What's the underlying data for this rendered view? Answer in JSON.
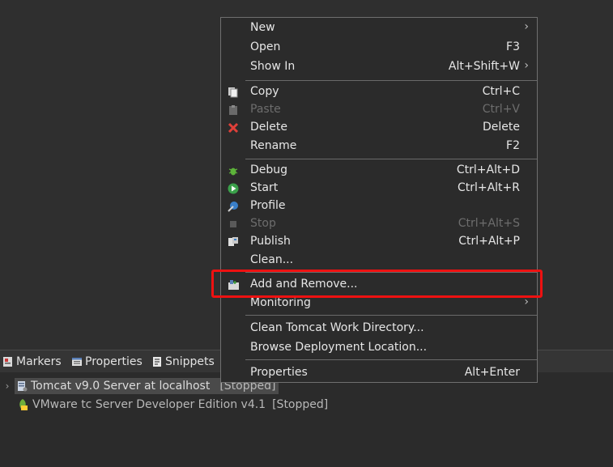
{
  "context_menu": {
    "items": [
      {
        "label": "New",
        "shortcut": "",
        "submenu": true,
        "icon": "",
        "enabled": true
      },
      {
        "label": "Open",
        "shortcut": "F3",
        "submenu": false,
        "icon": "",
        "enabled": true
      },
      {
        "label": "Show In",
        "shortcut": "Alt+Shift+W",
        "submenu": true,
        "icon": "",
        "enabled": true
      },
      {
        "label": "Copy",
        "shortcut": "Ctrl+C",
        "submenu": false,
        "icon": "copy-icon",
        "enabled": true
      },
      {
        "label": "Paste",
        "shortcut": "Ctrl+V",
        "submenu": false,
        "icon": "paste-icon",
        "enabled": false
      },
      {
        "label": "Delete",
        "shortcut": "Delete",
        "submenu": false,
        "icon": "delete-icon",
        "enabled": true
      },
      {
        "label": "Rename",
        "shortcut": "F2",
        "submenu": false,
        "icon": "",
        "enabled": true
      },
      {
        "label": "Debug",
        "shortcut": "Ctrl+Alt+D",
        "submenu": false,
        "icon": "debug-icon",
        "enabled": true
      },
      {
        "label": "Start",
        "shortcut": "Ctrl+Alt+R",
        "submenu": false,
        "icon": "start-icon",
        "enabled": true
      },
      {
        "label": "Profile",
        "shortcut": "",
        "submenu": false,
        "icon": "profile-icon",
        "enabled": true
      },
      {
        "label": "Stop",
        "shortcut": "Ctrl+Alt+S",
        "submenu": false,
        "icon": "stop-icon",
        "enabled": false
      },
      {
        "label": "Publish",
        "shortcut": "Ctrl+Alt+P",
        "submenu": false,
        "icon": "publish-icon",
        "enabled": true
      },
      {
        "label": "Clean...",
        "shortcut": "",
        "submenu": false,
        "icon": "",
        "enabled": true
      },
      {
        "label": "Add and Remove...",
        "shortcut": "",
        "submenu": false,
        "icon": "add-remove-icon",
        "enabled": true
      },
      {
        "label": "Monitoring",
        "shortcut": "",
        "submenu": true,
        "icon": "",
        "enabled": true
      },
      {
        "label": "Clean Tomcat Work Directory...",
        "shortcut": "",
        "submenu": false,
        "icon": "",
        "enabled": true
      },
      {
        "label": "Browse Deployment Location...",
        "shortcut": "",
        "submenu": false,
        "icon": "",
        "enabled": true
      },
      {
        "label": "Properties",
        "shortcut": "Alt+Enter",
        "submenu": false,
        "icon": "",
        "enabled": true
      }
    ],
    "submenu_arrow": "›",
    "highlight_color": "#ee1111"
  },
  "bottom_tabs": [
    {
      "label": "Markers",
      "icon": "markers-icon"
    },
    {
      "label": "Properties",
      "icon": "properties-icon"
    },
    {
      "label": "Snippets",
      "icon": "snippets-icon"
    }
  ],
  "servers": [
    {
      "name": "Tomcat v9.0 Server at localhost",
      "status": "[Stopped]",
      "icon": "tomcat-server-icon",
      "selected": true,
      "expandable": true
    },
    {
      "name": "VMware tc Server Developer Edition v4.1",
      "status": "[Stopped]",
      "icon": "vmware-tc-server-icon",
      "selected": false,
      "expandable": false
    }
  ]
}
